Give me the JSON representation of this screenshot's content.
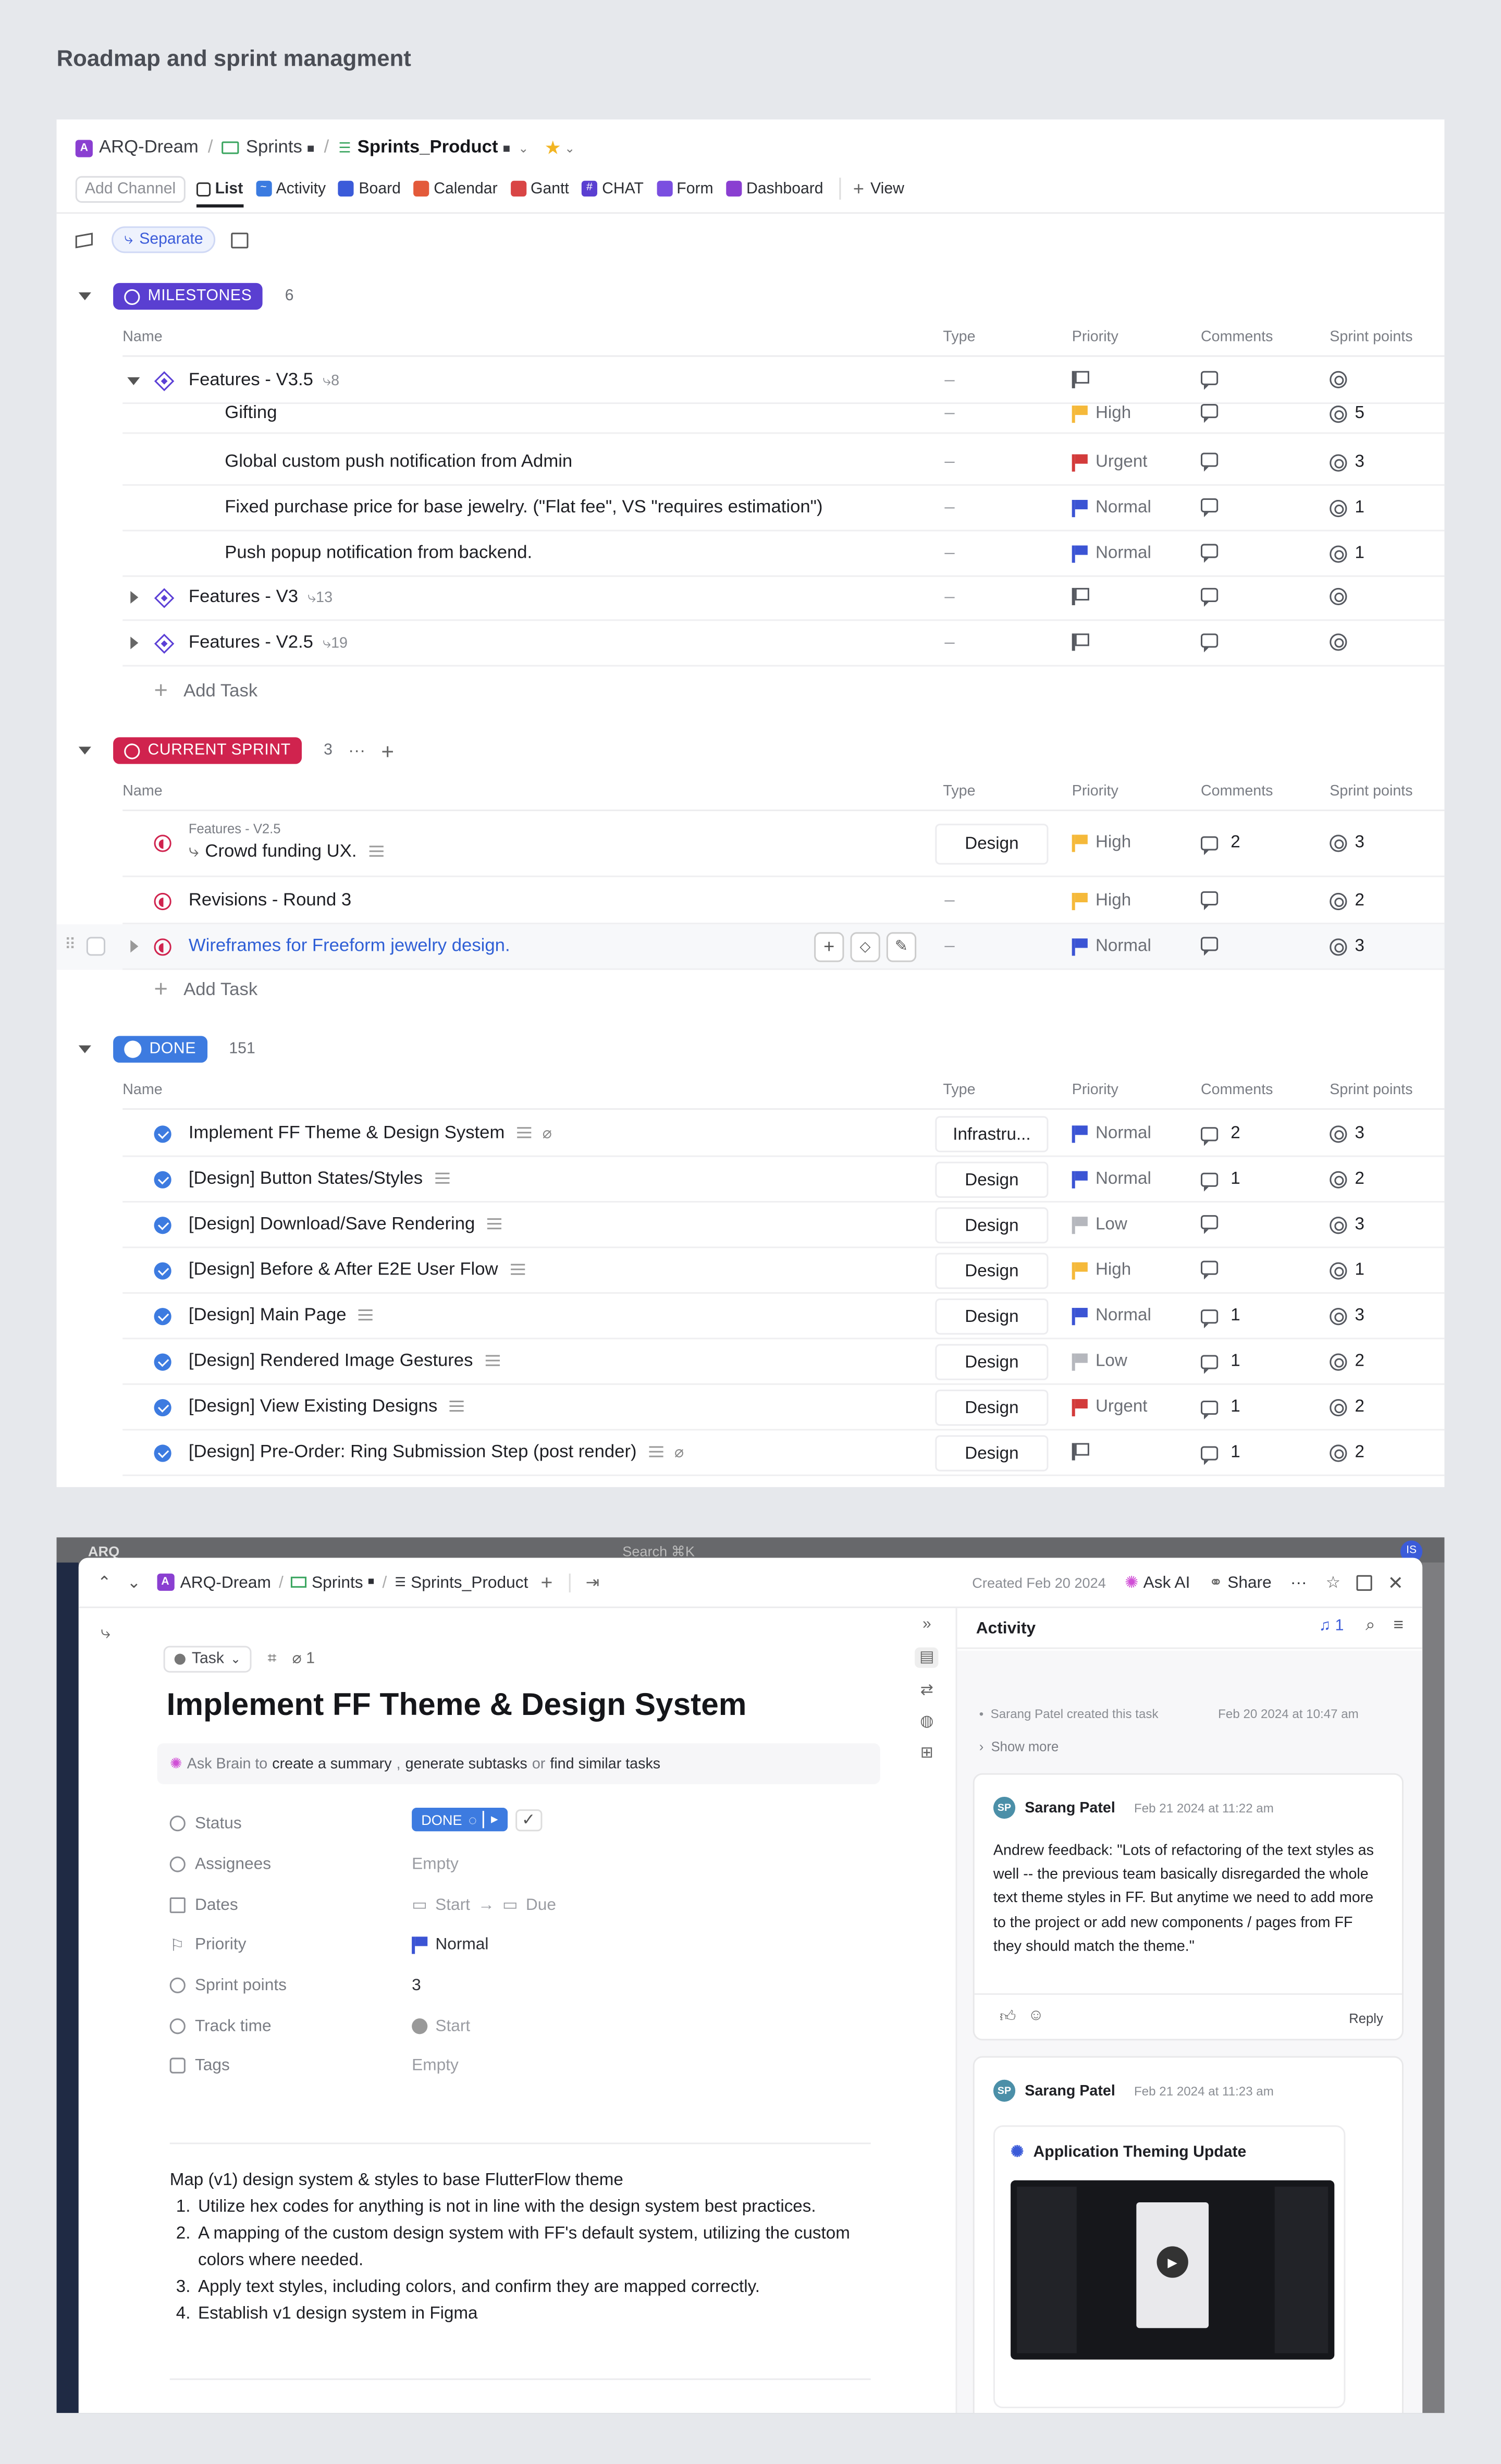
{
  "page_title": "Roadmap and sprint managment",
  "list_view": {
    "breadcrumb": {
      "workspace_badge": "A",
      "workspace": "ARQ-Dream",
      "space": "Sprints",
      "list": "Sprints_Product"
    },
    "add_channel": "Add Channel",
    "views": [
      "List",
      "Activity",
      "Board",
      "Calendar",
      "Gantt",
      "CHAT",
      "Form",
      "Dashboard"
    ],
    "add_view": "View",
    "group_toggle": "Separate",
    "columns": {
      "name": "Name",
      "type": "Type",
      "priority": "Priority",
      "comments": "Comments",
      "sprint_points": "Sprint points"
    },
    "add_task": "Add Task",
    "milestones": {
      "label": "MILESTONES",
      "count": "6",
      "rows": [
        {
          "name": "Features - V3.5",
          "subtasks": "8",
          "type": "–",
          "priority": "",
          "comments": "",
          "points": ""
        },
        {
          "name": "Gifting",
          "type": "–",
          "priority": "High",
          "comments": "",
          "points": "5"
        },
        {
          "name": "Global custom push notification from Admin",
          "type": "–",
          "priority": "Urgent",
          "comments": "",
          "points": "3"
        },
        {
          "name": "Fixed purchase price for base jewelry. (\"Flat fee\", VS \"requires estimation\")",
          "type": "–",
          "priority": "Normal",
          "comments": "",
          "points": "1"
        },
        {
          "name": "Push popup notification from backend.",
          "type": "–",
          "priority": "Normal",
          "comments": "",
          "points": "1"
        },
        {
          "name": "Features - V3",
          "subtasks": "13",
          "type": "–",
          "priority": "",
          "comments": "",
          "points": ""
        },
        {
          "name": "Features - V2.5",
          "subtasks": "19",
          "type": "–",
          "priority": "",
          "comments": "",
          "points": ""
        }
      ]
    },
    "current_sprint": {
      "label": "CURRENT SPRINT",
      "count": "3",
      "rows": [
        {
          "parent": "Features - V2.5",
          "name": "Crowd funding UX.",
          "type": "Design",
          "priority": "High",
          "comments": "2",
          "points": "3"
        },
        {
          "name": "Revisions - Round 3",
          "type": "–",
          "priority": "High",
          "comments": "",
          "points": "2"
        },
        {
          "name": "Wireframes for Freeform jewelry design.",
          "type": "–",
          "priority": "Normal",
          "comments": "",
          "points": "3"
        }
      ]
    },
    "done": {
      "label": "DONE",
      "count": "151",
      "rows": [
        {
          "name": "Implement FF Theme & Design System",
          "type": "Infrastru...",
          "priority": "Normal",
          "comments": "2",
          "points": "3"
        },
        {
          "name": "[Design] Button States/Styles",
          "type": "Design",
          "priority": "Normal",
          "comments": "1",
          "points": "2"
        },
        {
          "name": "[Design] Download/Save Rendering",
          "type": "Design",
          "priority": "Low",
          "comments": "",
          "points": "3"
        },
        {
          "name": "[Design] Before & After E2E User Flow",
          "type": "Design",
          "priority": "High",
          "comments": "",
          "points": "1"
        },
        {
          "name": "[Design] Main Page",
          "type": "Design",
          "priority": "Normal",
          "comments": "1",
          "points": "3"
        },
        {
          "name": "[Design] Rendered Image Gestures",
          "type": "Design",
          "priority": "Low",
          "comments": "1",
          "points": "2"
        },
        {
          "name": "[Design] View Existing Designs",
          "type": "Design",
          "priority": "Urgent",
          "comments": "1",
          "points": "2"
        },
        {
          "name": "[Design] Pre-Order: Ring Submission Step (post render)",
          "type": "Design",
          "priority": "",
          "comments": "1",
          "points": "2"
        }
      ]
    },
    "colors": {
      "milestones": "#5a3fd1",
      "sprint": "#d0234e",
      "done": "#3d7be0",
      "high": "#f5b93a",
      "urgent": "#d33b3b",
      "normal": "#3b54d4",
      "low": "#b5b7bd"
    }
  },
  "task_view": {
    "topbar": {
      "workspace": "ARQ",
      "search": "Search ⌘K",
      "avatar": "IS"
    },
    "breadcrumb": {
      "workspace": "ARQ-Dream",
      "space": "Sprints",
      "list": "Sprints_Product"
    },
    "created": "Created Feb 20 2024",
    "ask_ai": "Ask AI",
    "share": "Share",
    "task_type": "Task",
    "attach_count": "1",
    "title": "Implement FF Theme & Design System",
    "ask_brain": {
      "lead": "Ask Brain to",
      "a": "create a summary",
      "b": "generate subtasks",
      "or": "or",
      "c": "find similar tasks"
    },
    "fields": [
      {
        "label": "Status",
        "value": "DONE"
      },
      {
        "label": "Assignees",
        "value": "Empty"
      },
      {
        "label": "Dates",
        "value": "Start",
        "value2": "Due"
      },
      {
        "label": "Priority",
        "value": "Normal"
      },
      {
        "label": "Sprint points",
        "value": "3"
      },
      {
        "label": "Track time",
        "value": "Start"
      },
      {
        "label": "Tags",
        "value": "Empty"
      }
    ],
    "description": {
      "intro": "Map (v1) design system & styles to base FlutterFlow theme",
      "items": [
        "Utilize hex codes for anything is not in line with the design system best practices.",
        "A mapping of the custom design system with FF's default system, utilizing the custom colors where needed.",
        "Apply text styles, including colors, and confirm they are mapped correctly.",
        "Establish v1 design system in Figma"
      ]
    },
    "activity": {
      "title": "Activity",
      "notif_count": "1",
      "created_line": "Sarang Patel created this task",
      "created_time": "Feb 20 2024 at 10:47 am",
      "show_more": "Show more",
      "comment1": {
        "initials": "SP",
        "author": "Sarang Patel",
        "time": "Feb 21 2024 at 11:22 am",
        "text": "Andrew feedback: \"Lots of refactoring of the text styles as well -- the previous team basically disregarded the whole text theme styles in FF. But anytime we need to add more to the project or add new components / pages from FF they should match the theme.\"",
        "reply": "Reply"
      },
      "comment2": {
        "initials": "SP",
        "author": "Sarang Patel",
        "time": "Feb 21 2024 at 11:23 am",
        "attachment": "Application Theming Update"
      }
    }
  }
}
